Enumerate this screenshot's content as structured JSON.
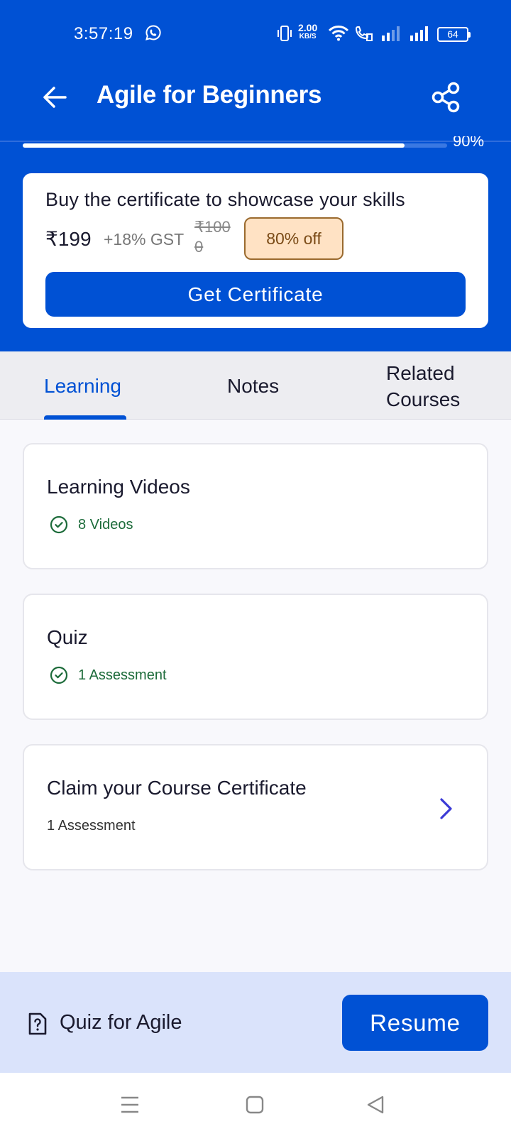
{
  "status_bar": {
    "time": "3:57:19",
    "net_speed_value": "2.00",
    "net_speed_unit": "KB/S",
    "battery": "64",
    "icons": [
      "whatsapp-icon",
      "vibrate-icon",
      "wifi-icon",
      "wifi-call-icon",
      "signal-icon",
      "signal-icon",
      "battery-icon"
    ]
  },
  "header": {
    "title": "Agile for Beginners",
    "back_icon": "arrow-left-icon",
    "share_icon": "share-icon"
  },
  "progress": {
    "percent_label": "90%",
    "fraction": 0.9
  },
  "certificate": {
    "heading": "Buy the certificate to showcase your skills",
    "price": "₹199",
    "gst": "+18% GST",
    "original_price": "₹1000",
    "discount": "80% off",
    "button": "Get Certificate"
  },
  "tabs": [
    {
      "label": "Learning",
      "active": true
    },
    {
      "label": "Notes",
      "active": false
    },
    {
      "label": "Related Courses",
      "active": false
    }
  ],
  "modules": [
    {
      "title": "Learning Videos",
      "subtitle": "8 Videos",
      "completed": true
    },
    {
      "title": "Quiz",
      "subtitle": "1 Assessment",
      "completed": true
    },
    {
      "title": "Claim your Course Certificate",
      "subtitle": "1 Assessment",
      "completed": false,
      "icon": "chevron-right-icon"
    }
  ],
  "bottom_bar": {
    "item_label": "Quiz for Agile",
    "item_icon": "quiz-icon",
    "button": "Resume"
  },
  "nav_bar": {
    "icons": [
      "menu-icon",
      "home-icon",
      "back-icon"
    ]
  },
  "colors": {
    "primary": "#0051d4",
    "discount_bg": "#ffe2c4",
    "completed_green": "#1c6b3a",
    "bottom_bar_bg": "#dae3fb"
  }
}
